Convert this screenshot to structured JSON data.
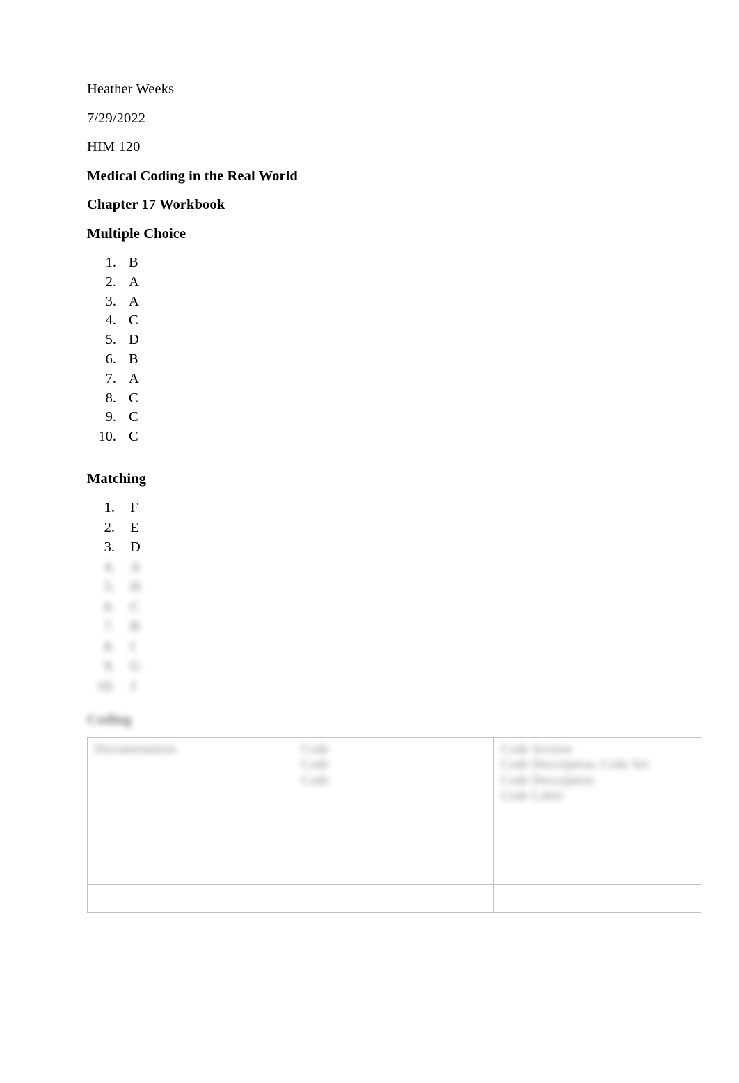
{
  "document": {
    "author": "Heather Weeks",
    "date": "7/29/2022",
    "course": "HIM 120",
    "title": "Medical Coding in the Real World",
    "subtitle": "Chapter 17 Workbook"
  },
  "sections": {
    "multiple_choice": {
      "heading": "Multiple Choice",
      "items": [
        {
          "num": "1.",
          "answer": "B"
        },
        {
          "num": "2.",
          "answer": "A"
        },
        {
          "num": "3.",
          "answer": "A"
        },
        {
          "num": "4.",
          "answer": "C"
        },
        {
          "num": "5.",
          "answer": "D"
        },
        {
          "num": "6.",
          "answer": "B"
        },
        {
          "num": "7.",
          "answer": "A"
        },
        {
          "num": "8.",
          "answer": "C"
        },
        {
          "num": "9.",
          "answer": "C"
        },
        {
          "num": "10.",
          "answer": "C"
        }
      ]
    },
    "matching": {
      "heading": "Matching",
      "items": [
        {
          "num": "1.",
          "answer": "F",
          "legible": true
        },
        {
          "num": "2.",
          "answer": "E",
          "legible": true
        },
        {
          "num": "3.",
          "answer": "D",
          "legible": true
        },
        {
          "num": "4.",
          "answer": "A",
          "legible": false
        },
        {
          "num": "5.",
          "answer": "H",
          "legible": false
        },
        {
          "num": "6.",
          "answer": "C",
          "legible": false
        },
        {
          "num": "7.",
          "answer": "B",
          "legible": false
        },
        {
          "num": "8.",
          "answer": "I",
          "legible": false
        },
        {
          "num": "9.",
          "answer": "G",
          "legible": false
        },
        {
          "num": "10.",
          "answer": "J",
          "legible": false
        }
      ]
    },
    "coding": {
      "heading": "Coding",
      "table": {
        "rows": [
          {
            "cells": [
              {
                "lines": [
                  "Documentation"
                ]
              },
              {
                "lines": [
                  "Code",
                  "",
                  "Code",
                  "Code"
                ]
              },
              {
                "lines": [
                  "Code Section",
                  "Code Description, Code Set",
                  "Code Description",
                  "Code Label"
                ]
              }
            ]
          },
          {
            "cells": [
              {
                "lines": [
                  ""
                ]
              },
              {
                "lines": [
                  ""
                ]
              },
              {
                "lines": [
                  ""
                ]
              }
            ]
          },
          {
            "cells": [
              {
                "lines": [
                  ""
                ]
              },
              {
                "lines": [
                  ""
                ]
              },
              {
                "lines": [
                  ""
                ]
              }
            ]
          },
          {
            "cells": [
              {
                "lines": [
                  ""
                ]
              },
              {
                "lines": [
                  ""
                ]
              },
              {
                "lines": [
                  ""
                ]
              }
            ]
          }
        ]
      }
    }
  }
}
